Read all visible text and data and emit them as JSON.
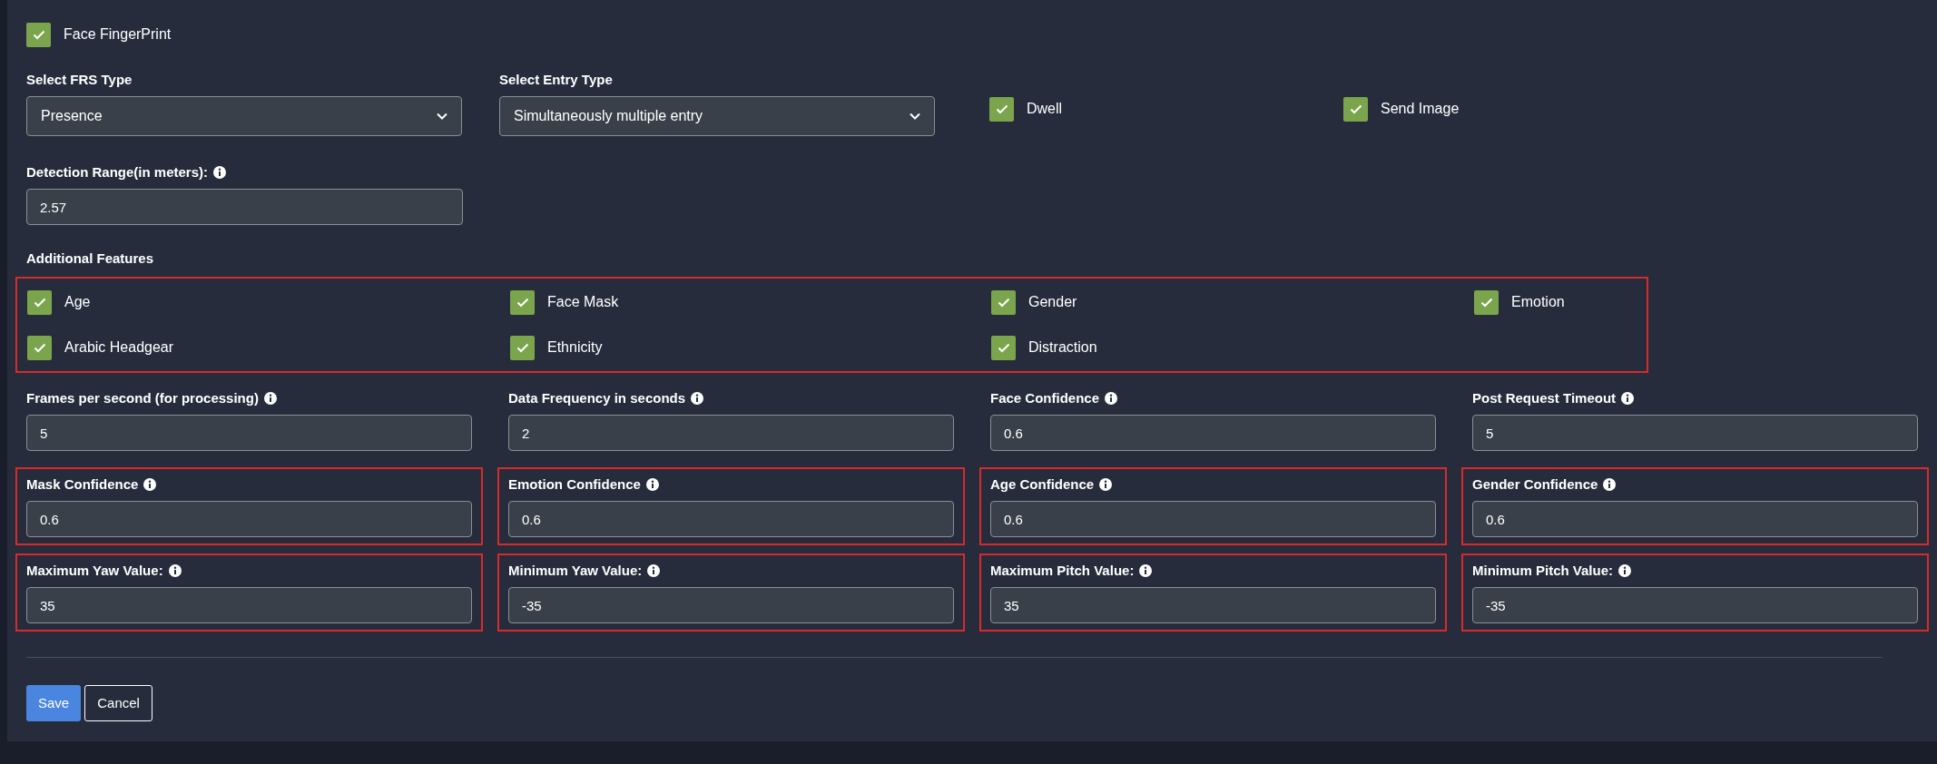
{
  "face_fingerprint": {
    "label": "Face FingerPrint",
    "checked": true
  },
  "selects": [
    {
      "label": "Select FRS Type",
      "value": "Presence"
    },
    {
      "label": "Select Entry Type",
      "value": "Simultaneously multiple entry"
    }
  ],
  "options": [
    {
      "label": "Dwell",
      "checked": true
    },
    {
      "label": "Send Image",
      "checked": true
    }
  ],
  "detection_range": {
    "label": "Detection Range(in meters):",
    "value": "2.57"
  },
  "additional_features": {
    "title": "Additional Features",
    "highlighted": true,
    "items": [
      {
        "label": "Age",
        "checked": true
      },
      {
        "label": "Face Mask",
        "checked": true
      },
      {
        "label": "Gender",
        "checked": true
      },
      {
        "label": "Emotion",
        "checked": true
      },
      {
        "label": "Arabic Headgear",
        "checked": true
      },
      {
        "label": "Ethnicity",
        "checked": true
      },
      {
        "label": "Distraction",
        "checked": true
      }
    ]
  },
  "fields": [
    {
      "label": "Frames per second (for processing)",
      "value": "5",
      "highlighted": false
    },
    {
      "label": "Data Frequency in seconds",
      "value": "2",
      "highlighted": false
    },
    {
      "label": "Face Confidence",
      "value": "0.6",
      "highlighted": false
    },
    {
      "label": "Post Request Timeout",
      "value": "5",
      "highlighted": false
    },
    {
      "label": "Mask Confidence",
      "value": "0.6",
      "highlighted": true
    },
    {
      "label": "Emotion Confidence",
      "value": "0.6",
      "highlighted": true
    },
    {
      "label": "Age Confidence",
      "value": "0.6",
      "highlighted": true
    },
    {
      "label": "Gender Confidence",
      "value": "0.6",
      "highlighted": true
    },
    {
      "label": "Maximum Yaw Value:",
      "value": "35",
      "highlighted": true
    },
    {
      "label": "Minimum Yaw Value:",
      "value": "-35",
      "highlighted": true
    },
    {
      "label": "Maximum Pitch Value:",
      "value": "35",
      "highlighted": true
    },
    {
      "label": "Minimum Pitch Value:",
      "value": "-35",
      "highlighted": true
    }
  ],
  "buttons": [
    {
      "label": "Save",
      "kind": "primary"
    },
    {
      "label": "Cancel",
      "kind": "secondary"
    }
  ]
}
